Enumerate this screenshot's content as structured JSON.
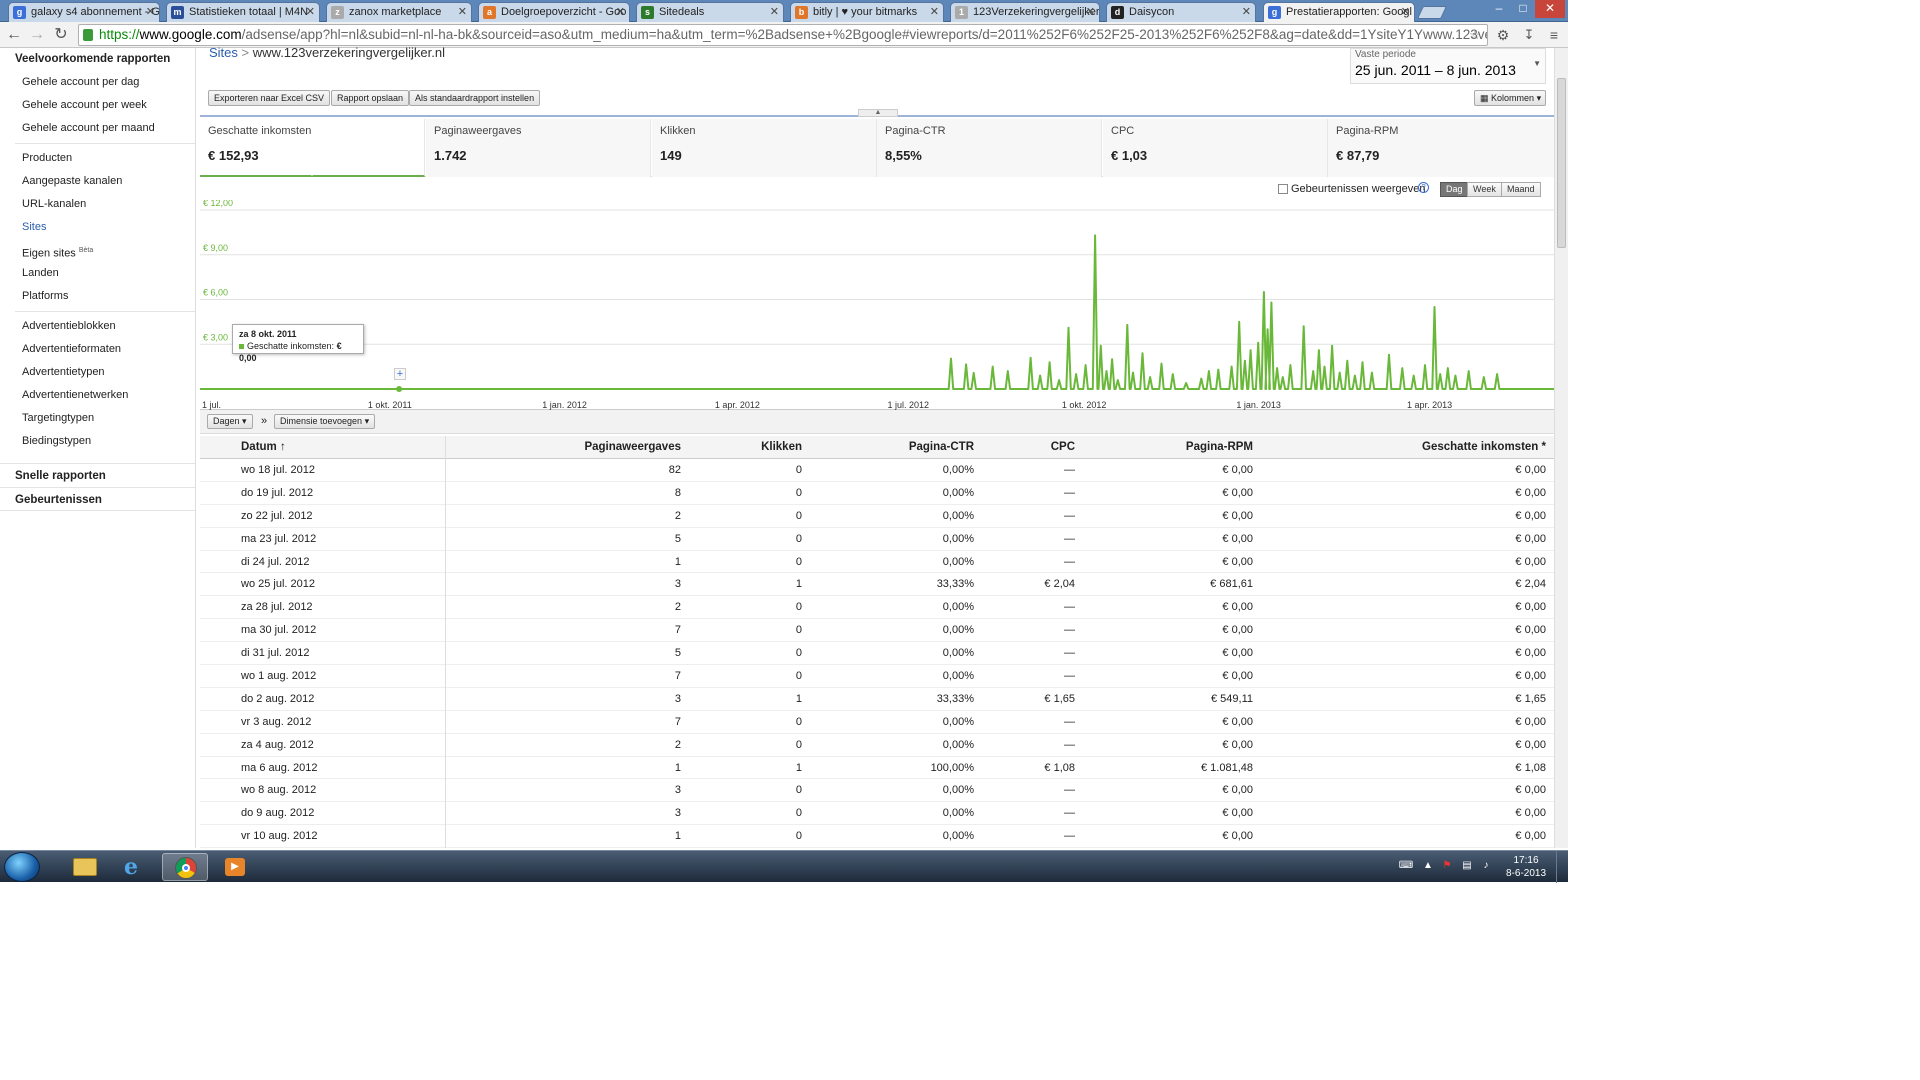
{
  "browser": {
    "tabs": [
      {
        "label": "galaxy s4 abonnement - G",
        "fav": "g",
        "color": "#3a6fd8"
      },
      {
        "label": "Statistieken totaal | M4N",
        "fav": "m",
        "color": "#2a4f9a"
      },
      {
        "label": "zanox marketplace",
        "fav": "z",
        "color": "#aaaaaa"
      },
      {
        "label": "Doelgroepoverzicht - Goo",
        "fav": "a",
        "color": "#e0762a"
      },
      {
        "label": "Sitedeals",
        "fav": "s",
        "color": "#2d7a2d"
      },
      {
        "label": "bitly | ♥ your bitmarks",
        "fav": "b",
        "color": "#e0762a"
      },
      {
        "label": "123Verzekeringvergelijker",
        "fav": "1",
        "color": "#aaaaaa"
      },
      {
        "label": "Daisycon",
        "fav": "d",
        "color": "#222222"
      },
      {
        "label": "Prestatierapporten: Googl",
        "fav": "g",
        "color": "#3a6fd8"
      }
    ],
    "active_tab": 8,
    "url": {
      "scheme": "https://",
      "domain": "www.google.com",
      "path": "/adsense/app?hl=nl&subid=nl-nl-ha-bk&sourceid=aso&utm_medium=ha&utm_term=%2Badsense+%2Bgoogle#viewreports/d=2011%252F6%252F25-2013%252F6%252F8&ag=date&dd=1YsiteY1Ywww.123verzekeringvergelijker.nl"
    }
  },
  "sidebar": {
    "heading": "Veelvoorkomende rapporten",
    "group1": [
      "Gehele account per dag",
      "Gehele account per week",
      "Gehele account per maand"
    ],
    "group2": [
      "Producten",
      "Aangepaste kanalen",
      "URL-kanalen",
      "Sites",
      "Eigen sites",
      "Landen",
      "Platforms"
    ],
    "beta_label": "Bèta",
    "active_item": "Sites",
    "group3": [
      "Advertentieblokken",
      "Advertentieformaten",
      "Advertentietypen",
      "Advertentienetwerken",
      "Targetingtypen",
      "Biedingstypen"
    ],
    "quick_reports": "Snelle rapporten",
    "events": "Gebeurtenissen"
  },
  "header": {
    "crumb_link": "Sites",
    "crumb_sep": ">",
    "crumb_site": "www.123verzekeringvergelijker.nl",
    "period_label": "Vaste periode",
    "period_value": "25 jun. 2011 – 8 jun. 2013",
    "btn_export": "Exporteren naar Excel CSV",
    "btn_save": "Rapport opslaan",
    "btn_default": "Als standaardrapport instellen",
    "btn_columns": "Kolommen"
  },
  "scorecards": [
    {
      "label": "Geschatte inkomsten",
      "value": "€ 152,93"
    },
    {
      "label": "Paginaweergaves",
      "value": "1.742"
    },
    {
      "label": "Klikken",
      "value": "149"
    },
    {
      "label": "Pagina-CTR",
      "value": "8,55%"
    },
    {
      "label": "CPC",
      "value": "€ 1,03"
    },
    {
      "label": "Pagina-RPM",
      "value": "€ 87,79"
    }
  ],
  "chart_controls": {
    "events_label": "Gebeurtenissen weergeven",
    "help": "?",
    "day": "Dag",
    "week": "Week",
    "month": "Maand"
  },
  "chart_data": {
    "type": "line",
    "series_name": "Geschatte inkomsten",
    "color": "#6ab83a",
    "ylim": [
      0,
      12
    ],
    "y_ticks": [
      "€ 3,00",
      "€ 6,00",
      "€ 9,00",
      "€ 12,00"
    ],
    "y_tick_values": [
      3,
      6,
      9,
      12
    ],
    "x_ticks": [
      "1 jul.",
      "1 okt. 2011",
      "1 jan. 2012",
      "1 apr. 2012",
      "1 jul. 2012",
      "1 okt. 2012",
      "1 jan. 2013",
      "1 apr. 2013"
    ],
    "x_tick_dates": [
      "2011-07-01",
      "2011-10-01",
      "2012-01-01",
      "2012-04-01",
      "2012-07-01",
      "2012-10-01",
      "2013-01-01",
      "2013-04-01"
    ],
    "x_range": [
      "2011-06-25",
      "2013-06-08"
    ],
    "points": [
      [
        "2012-07-25",
        2.04
      ],
      [
        "2012-08-02",
        1.65
      ],
      [
        "2012-08-06",
        1.08
      ],
      [
        "2012-08-16",
        1.5
      ],
      [
        "2012-08-24",
        1.2
      ],
      [
        "2012-09-05",
        2.1
      ],
      [
        "2012-09-10",
        0.9
      ],
      [
        "2012-09-15",
        1.8
      ],
      [
        "2012-09-20",
        0.6
      ],
      [
        "2012-09-25",
        4.1
      ],
      [
        "2012-09-29",
        1.0
      ],
      [
        "2012-10-04",
        1.6
      ],
      [
        "2012-10-09",
        10.3
      ],
      [
        "2012-10-12",
        2.9
      ],
      [
        "2012-10-15",
        1.2
      ],
      [
        "2012-10-18",
        2.0
      ],
      [
        "2012-10-21",
        0.6
      ],
      [
        "2012-10-26",
        4.3
      ],
      [
        "2012-10-29",
        1.1
      ],
      [
        "2012-11-03",
        2.4
      ],
      [
        "2012-11-07",
        0.8
      ],
      [
        "2012-11-13",
        1.7
      ],
      [
        "2012-11-19",
        1.0
      ],
      [
        "2012-11-26",
        0.4
      ],
      [
        "2012-12-04",
        0.7
      ],
      [
        "2012-12-08",
        1.2
      ],
      [
        "2012-12-13",
        1.3
      ],
      [
        "2012-12-20",
        1.5
      ],
      [
        "2012-12-24",
        4.5
      ],
      [
        "2012-12-27",
        1.9
      ],
      [
        "2012-12-30",
        2.6
      ],
      [
        "2013-01-03",
        3.1
      ],
      [
        "2013-01-06",
        6.5
      ],
      [
        "2013-01-08",
        4.0
      ],
      [
        "2013-01-10",
        5.8
      ],
      [
        "2013-01-13",
        1.4
      ],
      [
        "2013-01-16",
        0.8
      ],
      [
        "2013-01-20",
        1.6
      ],
      [
        "2013-01-27",
        4.2
      ],
      [
        "2013-02-01",
        1.2
      ],
      [
        "2013-02-04",
        2.6
      ],
      [
        "2013-02-07",
        1.5
      ],
      [
        "2013-02-11",
        2.9
      ],
      [
        "2013-02-15",
        1.1
      ],
      [
        "2013-02-19",
        1.9
      ],
      [
        "2013-02-23",
        0.9
      ],
      [
        "2013-02-27",
        1.8
      ],
      [
        "2013-03-04",
        1.1
      ],
      [
        "2013-03-13",
        2.3
      ],
      [
        "2013-03-20",
        1.4
      ],
      [
        "2013-03-26",
        0.9
      ],
      [
        "2013-04-01",
        1.6
      ],
      [
        "2013-04-06",
        5.5
      ],
      [
        "2013-04-09",
        1.0
      ],
      [
        "2013-04-13",
        1.4
      ],
      [
        "2013-04-17",
        0.9
      ],
      [
        "2013-04-24",
        1.2
      ],
      [
        "2013-05-02",
        0.8
      ],
      [
        "2013-05-09",
        1.0
      ]
    ],
    "tooltip": {
      "date": "za 8 okt. 2011",
      "label": "Geschatte inkomsten:",
      "value": "€ 0,00"
    },
    "annotation_plus": "+"
  },
  "dim_bar": {
    "days": "Dagen",
    "sep": "»",
    "add_dim": "Dimensie toevoegen"
  },
  "table": {
    "columns": [
      "Datum ↑",
      "Paginaweergaves",
      "Klikken",
      "Pagina-CTR",
      "CPC",
      "Pagina-RPM",
      "Geschatte inkomsten *"
    ],
    "rows": [
      [
        "wo 18 jul. 2012",
        "82",
        "0",
        "0,00%",
        "—",
        "€ 0,00",
        "€ 0,00"
      ],
      [
        "do 19 jul. 2012",
        "8",
        "0",
        "0,00%",
        "—",
        "€ 0,00",
        "€ 0,00"
      ],
      [
        "zo 22 jul. 2012",
        "2",
        "0",
        "0,00%",
        "—",
        "€ 0,00",
        "€ 0,00"
      ],
      [
        "ma 23 jul. 2012",
        "5",
        "0",
        "0,00%",
        "—",
        "€ 0,00",
        "€ 0,00"
      ],
      [
        "di 24 jul. 2012",
        "1",
        "0",
        "0,00%",
        "—",
        "€ 0,00",
        "€ 0,00"
      ],
      [
        "wo 25 jul. 2012",
        "3",
        "1",
        "33,33%",
        "€ 2,04",
        "€ 681,61",
        "€ 2,04"
      ],
      [
        "za 28 jul. 2012",
        "2",
        "0",
        "0,00%",
        "—",
        "€ 0,00",
        "€ 0,00"
      ],
      [
        "ma 30 jul. 2012",
        "7",
        "0",
        "0,00%",
        "—",
        "€ 0,00",
        "€ 0,00"
      ],
      [
        "di 31 jul. 2012",
        "5",
        "0",
        "0,00%",
        "—",
        "€ 0,00",
        "€ 0,00"
      ],
      [
        "wo 1 aug. 2012",
        "7",
        "0",
        "0,00%",
        "—",
        "€ 0,00",
        "€ 0,00"
      ],
      [
        "do 2 aug. 2012",
        "3",
        "1",
        "33,33%",
        "€ 1,65",
        "€ 549,11",
        "€ 1,65"
      ],
      [
        "vr 3 aug. 2012",
        "7",
        "0",
        "0,00%",
        "—",
        "€ 0,00",
        "€ 0,00"
      ],
      [
        "za 4 aug. 2012",
        "2",
        "0",
        "0,00%",
        "—",
        "€ 0,00",
        "€ 0,00"
      ],
      [
        "ma 6 aug. 2012",
        "1",
        "1",
        "100,00%",
        "€ 1,08",
        "€ 1.081,48",
        "€ 1,08"
      ],
      [
        "wo 8 aug. 2012",
        "3",
        "0",
        "0,00%",
        "—",
        "€ 0,00",
        "€ 0,00"
      ],
      [
        "do 9 aug. 2012",
        "3",
        "0",
        "0,00%",
        "—",
        "€ 0,00",
        "€ 0,00"
      ],
      [
        "vr 10 aug. 2012",
        "1",
        "0",
        "0,00%",
        "—",
        "€ 0,00",
        "€ 0,00"
      ]
    ]
  },
  "taskbar": {
    "time": "17:16",
    "date": "8-6-2013",
    "apps": [
      "explorer-icon",
      "internet-explorer-icon",
      "chrome-icon",
      "media-player-icon"
    ]
  }
}
